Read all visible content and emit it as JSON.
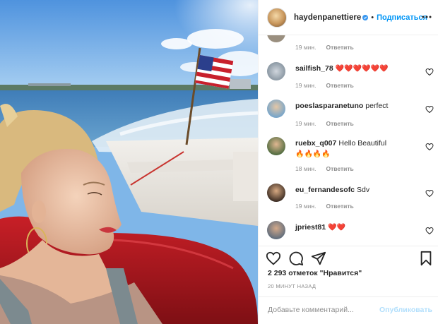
{
  "header": {
    "username": "haydenpanettiere",
    "dot": "•",
    "follow_label": "Подписаться",
    "verified_icon": "verified-badge-icon",
    "more_icon": "more-options-icon"
  },
  "comments": [
    {
      "username": "",
      "text": "",
      "time": "19 мин.",
      "reply": "Ответить"
    },
    {
      "username": "sailfish_78",
      "text": "",
      "emoji": "❤️❤️❤️❤️❤️❤️",
      "time": "19 мин.",
      "reply": "Ответить"
    },
    {
      "username": "poeslasparanetuno",
      "text": "perfect",
      "time": "19 мин.",
      "reply": "Ответить"
    },
    {
      "username": "ruebx_q007",
      "text": "Hello Beautiful",
      "emoji": "🔥🔥🔥🔥",
      "time": "18 мин.",
      "reply": "Ответить"
    },
    {
      "username": "eu_fernandesofc",
      "text": "Sdv",
      "time": "19 мин.",
      "reply": "Ответить"
    },
    {
      "username": "jpriest81",
      "text": "",
      "emoji": "❤️❤️",
      "time": "",
      "reply": ""
    }
  ],
  "actions": {
    "likes": "2 293 отметок \"Нравится\"",
    "time_ago": "20 МИНУТ НАЗАД",
    "icons": [
      "like-icon",
      "comment-icon",
      "share-icon",
      "save-icon"
    ]
  },
  "add_comment": {
    "placeholder": "Добавьте комментарий...",
    "post_label": "Опубликовать"
  },
  "colors": {
    "accent": "#0095f6",
    "post_disabled": "#b2dffc",
    "meta_gray": "#8e8e8e",
    "heart": "#e0245e"
  }
}
